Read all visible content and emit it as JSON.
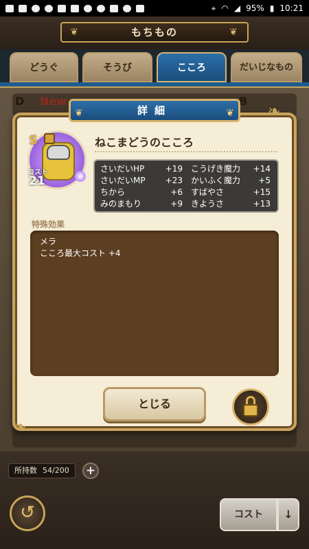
{
  "status": {
    "battery": "95%",
    "time": "10:21"
  },
  "header": {
    "title": "もちもの"
  },
  "tabs": [
    {
      "label": "どうぐ"
    },
    {
      "label": "そうび"
    },
    {
      "label": "こころ"
    },
    {
      "label": "だいじなもの"
    }
  ],
  "background": {
    "new_badge": "New",
    "rank_left": "D",
    "rank_right": "B"
  },
  "modal": {
    "title": "詳細",
    "rank": "S",
    "cost_label": "コスト",
    "cost": "21",
    "item_name": "ねこまどうのこころ",
    "stats": [
      {
        "n1": "さいだいHP",
        "v1": "+19",
        "n2": "こうげき魔力",
        "v2": "+14"
      },
      {
        "n1": "さいだいMP",
        "v1": "+23",
        "n2": "かいふく魔力",
        "v2": "+5"
      },
      {
        "n1": "ちから",
        "v1": "+6",
        "n2": "すばやさ",
        "v2": "+15"
      },
      {
        "n1": "みのまもり",
        "v1": "+9",
        "n2": "きようさ",
        "v2": "+13"
      }
    ],
    "effect_label": "特殊効果",
    "effects": [
      "メラ",
      "こころ最大コスト +4"
    ],
    "close_label": "とじる"
  },
  "footer": {
    "owned_label": "所持数",
    "owned_value": "54/200",
    "sort_label": "コスト",
    "sort_arrow": "↓"
  }
}
